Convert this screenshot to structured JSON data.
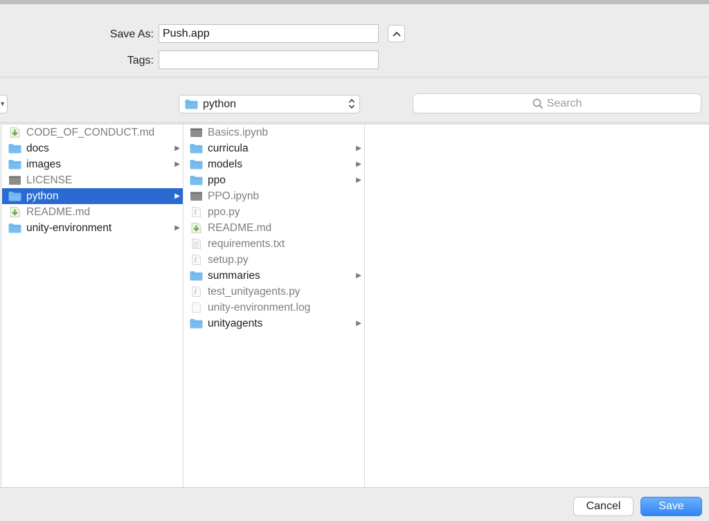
{
  "form": {
    "save_as_label": "Save As:",
    "save_as_value": "Push.app",
    "tags_label": "Tags:",
    "tags_value": ""
  },
  "nav": {
    "current_folder": "python",
    "search_placeholder": "Search"
  },
  "columns": [
    {
      "items": [
        {
          "name": "CODE_OF_CONDUCT.md",
          "icon": "markdown-file-icon",
          "folder": false,
          "dim": true,
          "selected": false
        },
        {
          "name": "docs",
          "icon": "folder-icon",
          "folder": true,
          "dim": false,
          "selected": false
        },
        {
          "name": "images",
          "icon": "folder-icon",
          "folder": true,
          "dim": false,
          "selected": false
        },
        {
          "name": "LICENSE",
          "icon": "generic-file-icon",
          "folder": false,
          "dim": true,
          "selected": false
        },
        {
          "name": "python",
          "icon": "folder-icon",
          "folder": true,
          "dim": false,
          "selected": true
        },
        {
          "name": "README.md",
          "icon": "markdown-file-icon",
          "folder": false,
          "dim": true,
          "selected": false
        },
        {
          "name": "unity-environment",
          "icon": "folder-icon",
          "folder": true,
          "dim": false,
          "selected": false
        }
      ]
    },
    {
      "items": [
        {
          "name": "Basics.ipynb",
          "icon": "generic-file-icon",
          "folder": false,
          "dim": true,
          "selected": false
        },
        {
          "name": "curricula",
          "icon": "folder-icon",
          "folder": true,
          "dim": false,
          "selected": false
        },
        {
          "name": "models",
          "icon": "folder-icon",
          "folder": true,
          "dim": false,
          "selected": false
        },
        {
          "name": "ppo",
          "icon": "folder-icon",
          "folder": true,
          "dim": false,
          "selected": false
        },
        {
          "name": "PPO.ipynb",
          "icon": "generic-file-icon",
          "folder": false,
          "dim": true,
          "selected": false
        },
        {
          "name": "ppo.py",
          "icon": "python-file-icon",
          "folder": false,
          "dim": true,
          "selected": false
        },
        {
          "name": "README.md",
          "icon": "markdown-file-icon",
          "folder": false,
          "dim": true,
          "selected": false
        },
        {
          "name": "requirements.txt",
          "icon": "text-file-icon",
          "folder": false,
          "dim": true,
          "selected": false
        },
        {
          "name": "setup.py",
          "icon": "python-file-icon",
          "folder": false,
          "dim": true,
          "selected": false
        },
        {
          "name": "summaries",
          "icon": "folder-icon",
          "folder": true,
          "dim": false,
          "selected": false
        },
        {
          "name": "test_unityagents.py",
          "icon": "python-file-icon",
          "folder": false,
          "dim": true,
          "selected": false
        },
        {
          "name": "unity-environment.log",
          "icon": "blank-file-icon",
          "folder": false,
          "dim": true,
          "selected": false
        },
        {
          "name": "unityagents",
          "icon": "folder-icon",
          "folder": true,
          "dim": false,
          "selected": false
        }
      ]
    }
  ],
  "buttons": {
    "cancel": "Cancel",
    "save": "Save"
  },
  "colors": {
    "selection": "#2a6ad2",
    "folder": "#6cb8f0",
    "primary_button": "#2f86f6"
  }
}
